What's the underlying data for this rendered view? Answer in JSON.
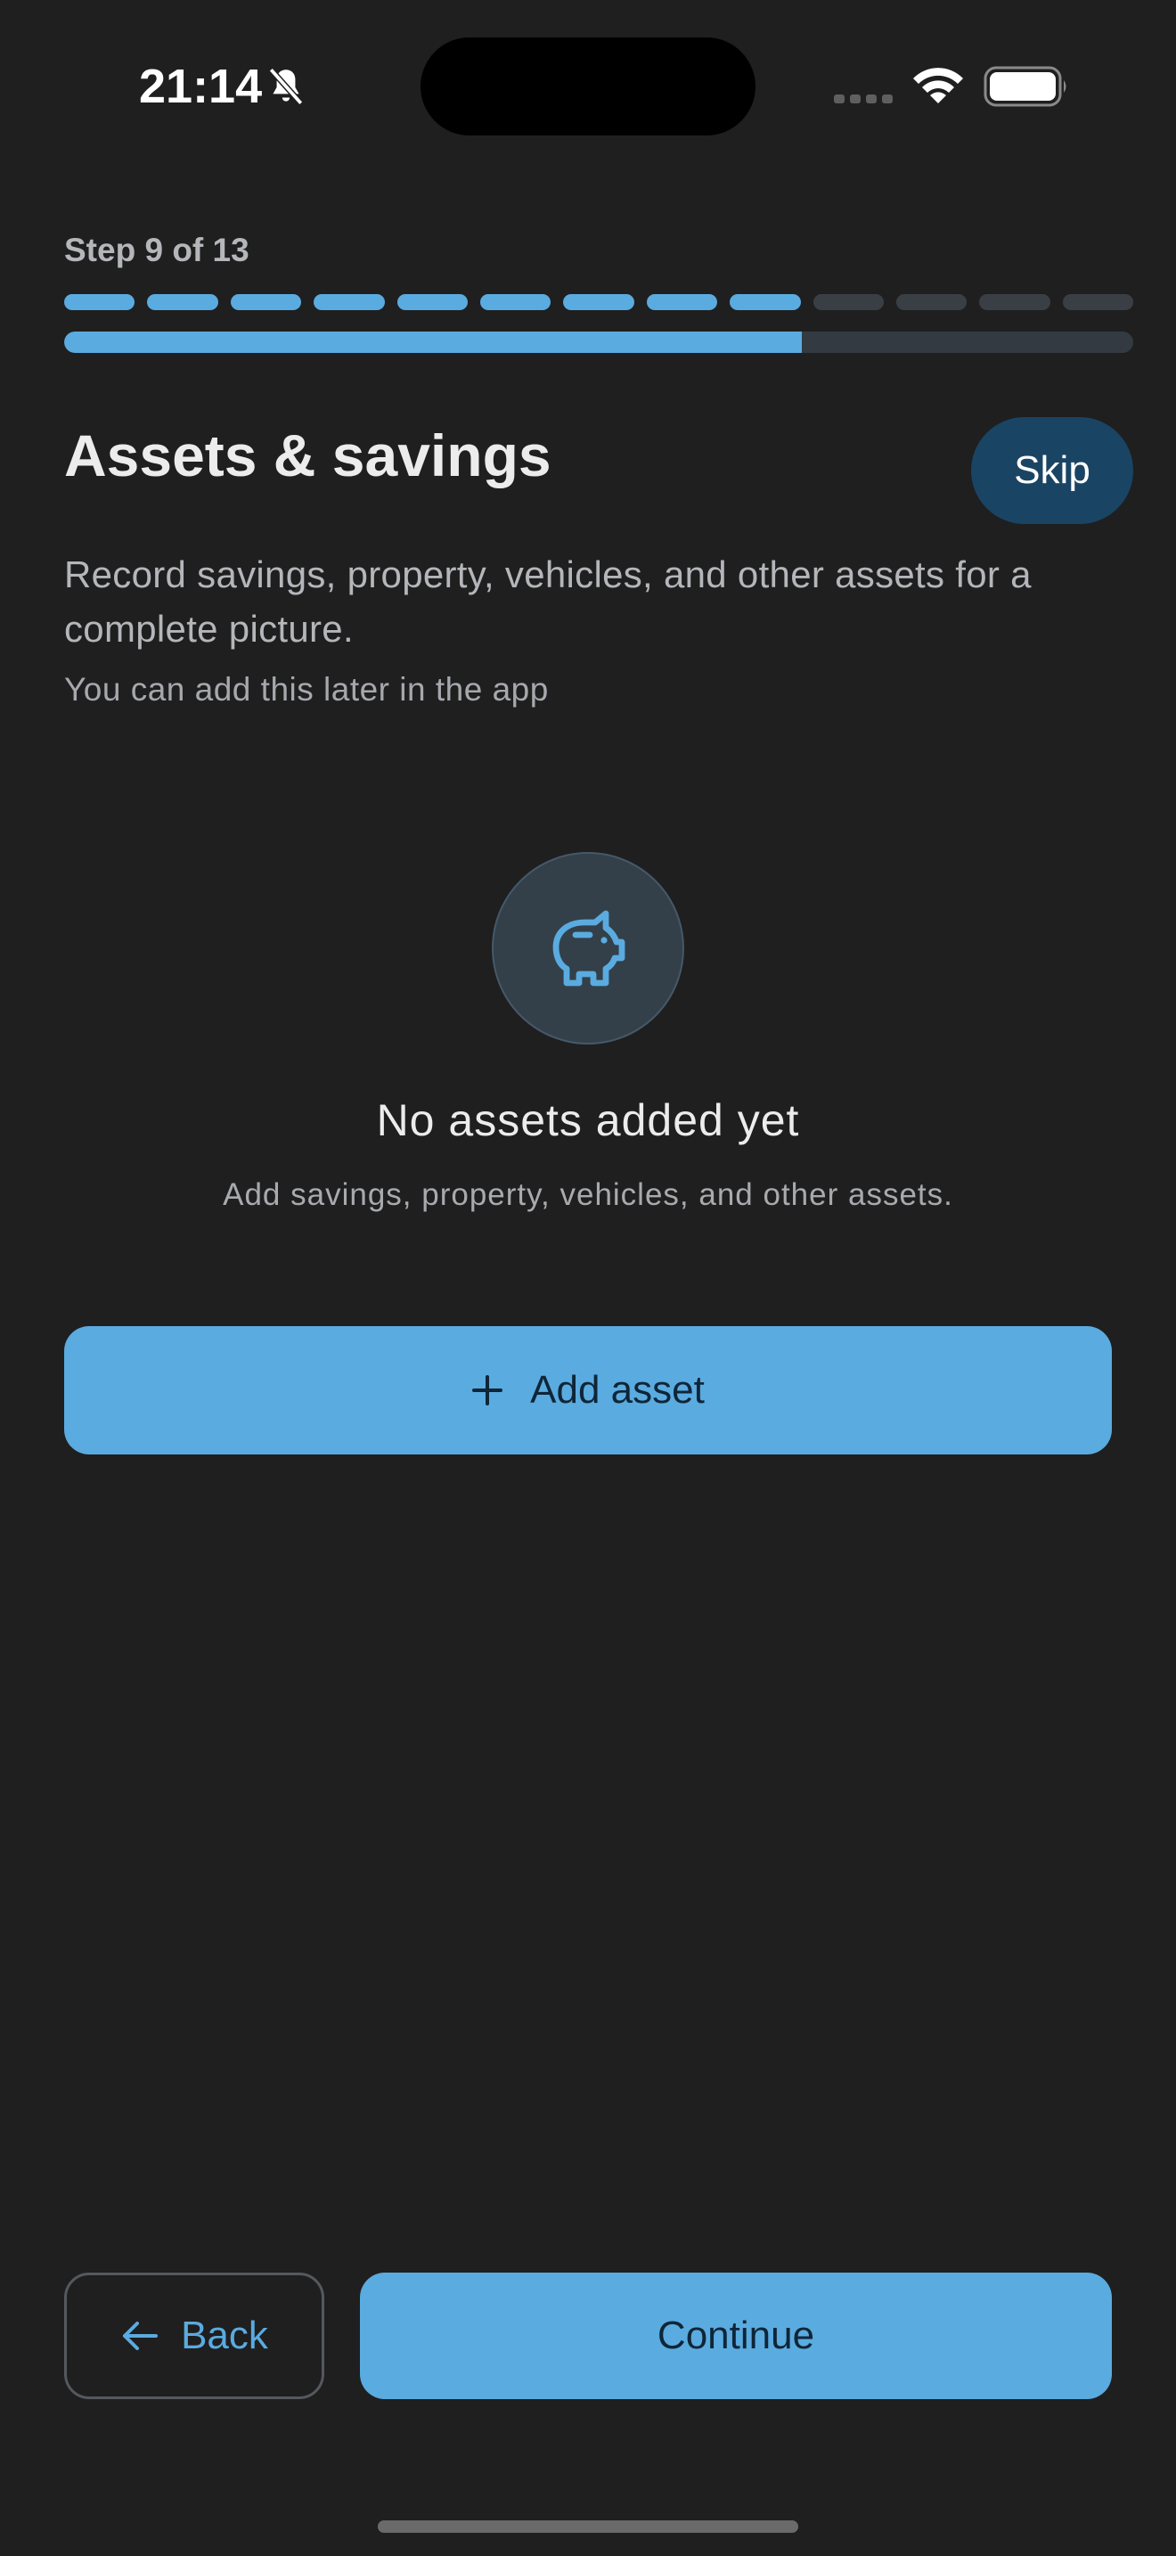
{
  "status_bar": {
    "time": "21:14",
    "icons": [
      "bell-slash-icon",
      "cellular-signal-icon",
      "wifi-icon",
      "battery-icon"
    ]
  },
  "progress": {
    "step_label": "Step 9 of 13",
    "current_step": 9,
    "total_steps": 13,
    "fraction_complete": 0.69
  },
  "header": {
    "title": "Assets & savings",
    "skip_label": "Skip"
  },
  "content": {
    "description": "Record savings, property, vehicles, and other assets for a complete picture.",
    "hint": "You can add this later in the app"
  },
  "empty_state": {
    "icon": "piggy-bank-icon",
    "title": "No assets added yet",
    "subtitle": "Add savings, property, vehicles, and other assets."
  },
  "actions": {
    "add_label": "Add asset",
    "back_label": "Back",
    "continue_label": "Continue"
  },
  "colors": {
    "background": "#1f1f1f",
    "accent": "#5aabe0",
    "skip_background": "#1a4464",
    "inactive_segment": "#3a3f46"
  }
}
